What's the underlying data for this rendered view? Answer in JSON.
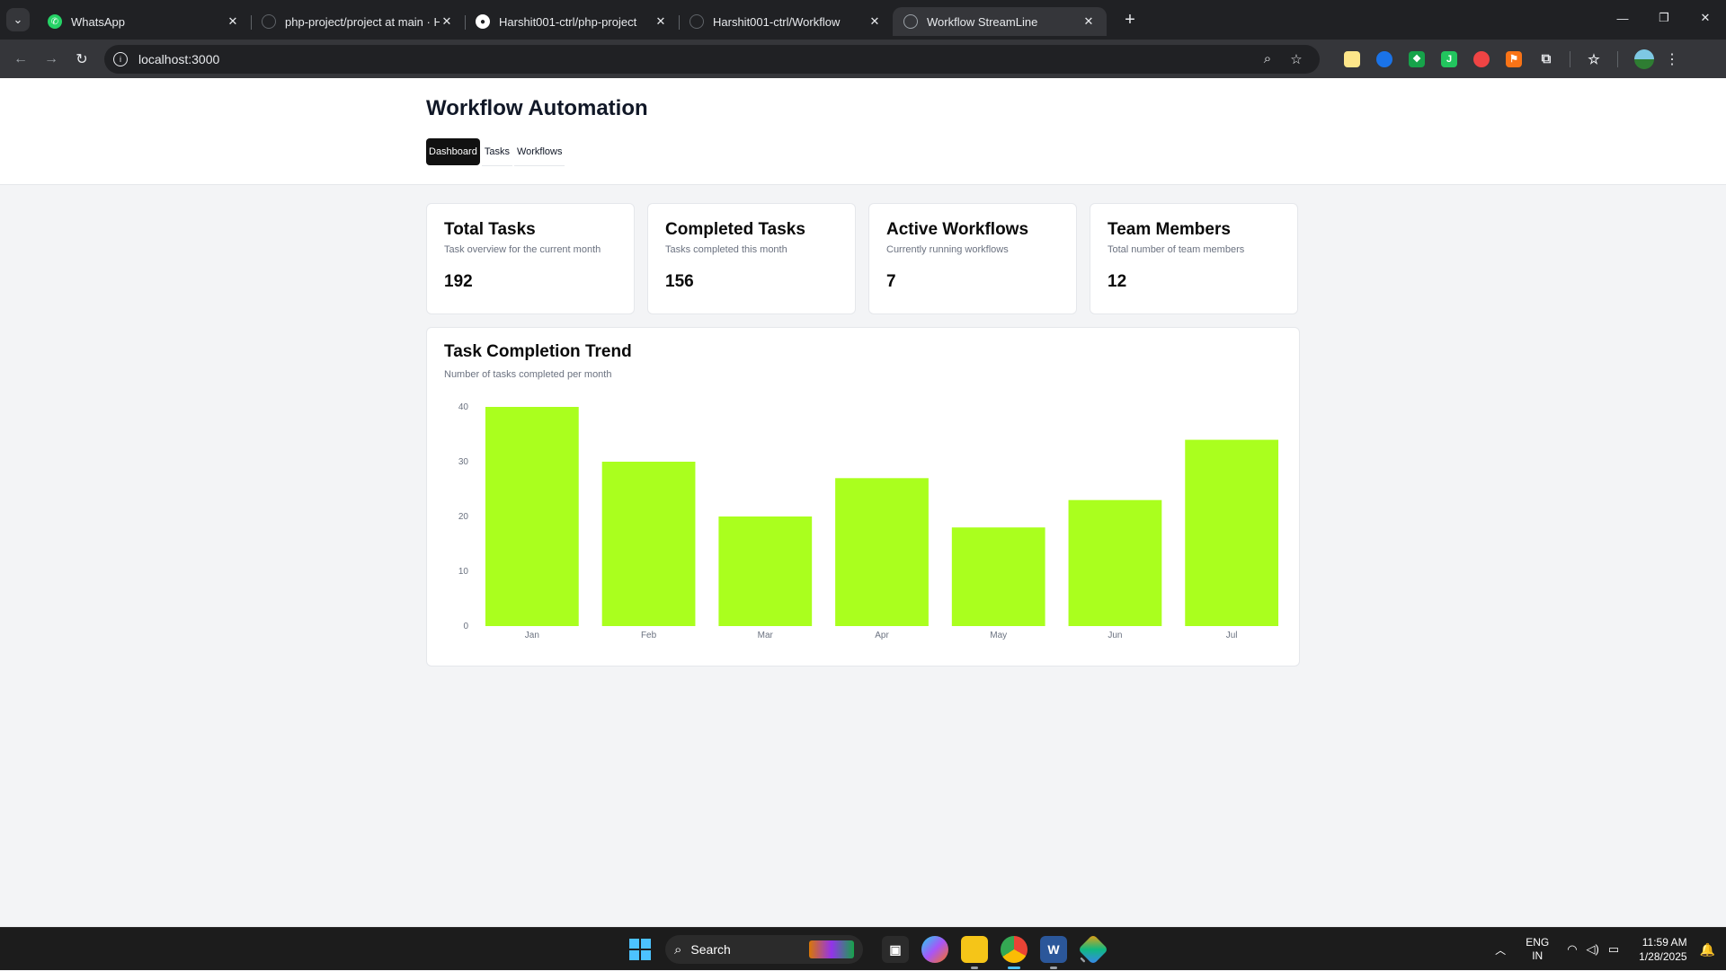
{
  "browser": {
    "tabs": [
      {
        "title": "WhatsApp",
        "icon": "whatsapp-icon",
        "color": "#25d366",
        "active": false
      },
      {
        "title": "php-project/project at main · H",
        "icon": "github-icon",
        "color": "#5f6368",
        "active": false
      },
      {
        "title": "Harshit001-ctrl/php-project",
        "icon": "github-icon",
        "color": "#ffffff",
        "active": false
      },
      {
        "title": "Harshit001-ctrl/Workflow",
        "icon": "github-icon",
        "color": "#5f6368",
        "active": false
      },
      {
        "title": "Workflow StreamLine",
        "icon": "globe-icon",
        "color": "#9aa0a6",
        "active": true
      }
    ],
    "url": "localhost:3000"
  },
  "app": {
    "title": "Workflow Automation",
    "tabs": [
      {
        "label": "Dashboard",
        "active": true
      },
      {
        "label": "Tasks",
        "active": false
      },
      {
        "label": "Workflows",
        "active": false
      }
    ],
    "cards": [
      {
        "title": "Total Tasks",
        "desc": "Task overview for the current month",
        "value": "192"
      },
      {
        "title": "Completed Tasks",
        "desc": "Tasks completed this month",
        "value": "156"
      },
      {
        "title": "Active Workflows",
        "desc": "Currently running workflows",
        "value": "7"
      },
      {
        "title": "Team Members",
        "desc": "Total number of team members",
        "value": "12"
      }
    ],
    "chart": {
      "title": "Task Completion Trend",
      "desc": "Number of tasks completed per month"
    }
  },
  "chart_data": {
    "type": "bar",
    "categories": [
      "Jan",
      "Feb",
      "Mar",
      "Apr",
      "May",
      "Jun",
      "Jul"
    ],
    "values": [
      40,
      30,
      20,
      27,
      18,
      23,
      34
    ],
    "ylim": [
      0,
      40
    ],
    "yticks": [
      0,
      10,
      20,
      30,
      40
    ],
    "bar_color": "#aaff1e",
    "grid": false,
    "legend": "none"
  },
  "taskbar": {
    "search_label": "Search",
    "apps": [
      {
        "icon": "terminal-icon",
        "color": "#2b2b2b"
      },
      {
        "icon": "copilot-icon",
        "color": "#7c3aed"
      },
      {
        "icon": "file-explorer-icon",
        "color": "#f5c518"
      },
      {
        "icon": "chrome-icon",
        "color": "#1a73e8"
      },
      {
        "icon": "word-icon",
        "color": "#2b579a"
      },
      {
        "icon": "git-icon",
        "color": "#f59e0b"
      }
    ],
    "language": "ENG",
    "region": "IN",
    "time": "11:59 AM",
    "date": "1/28/2025"
  }
}
